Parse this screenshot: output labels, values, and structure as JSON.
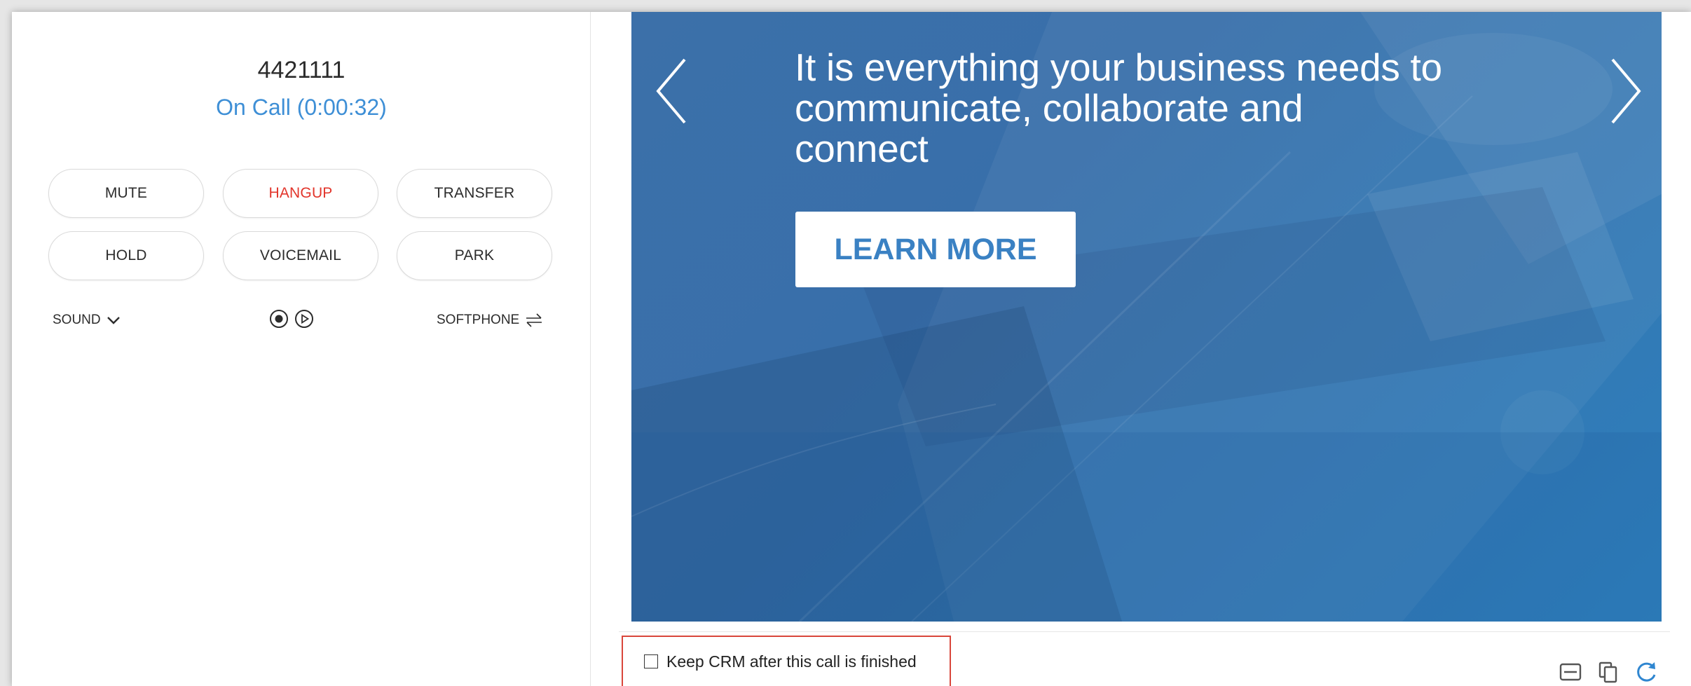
{
  "call": {
    "number": "4421111",
    "status": "On Call (0:00:32)"
  },
  "buttons": {
    "mute": "MUTE",
    "hangup": "HANGUP",
    "transfer": "TRANSFER",
    "hold": "HOLD",
    "voicemail": "VOICEMAIL",
    "park": "PARK"
  },
  "controls": {
    "sound": "SOUND",
    "softphone": "SOFTPHONE"
  },
  "banner": {
    "headline": "It is everything your business needs to communicate, collaborate and connect",
    "cta": "LEARN MORE"
  },
  "crm": {
    "keep_label": "Keep CRM after this call is finished",
    "keep_checked": false
  },
  "icons": {
    "sound_toggle": "chevron-down-icon",
    "record": "record-icon",
    "play": "play-icon",
    "softphone_switch": "swap-arrows-icon",
    "carousel_prev": "chevron-left-icon",
    "carousel_next": "chevron-right-icon",
    "window_minimize": "window-icon",
    "copy": "copy-icon",
    "refresh": "refresh-icon"
  },
  "colors": {
    "status_blue": "#3e8fd6",
    "hangup_red": "#e2352b",
    "banner_blue": "#3a73ae",
    "cta_text_blue": "#3a81c3",
    "highlight_red": "#d9463b",
    "toolbar_blue": "#2f86d0"
  }
}
